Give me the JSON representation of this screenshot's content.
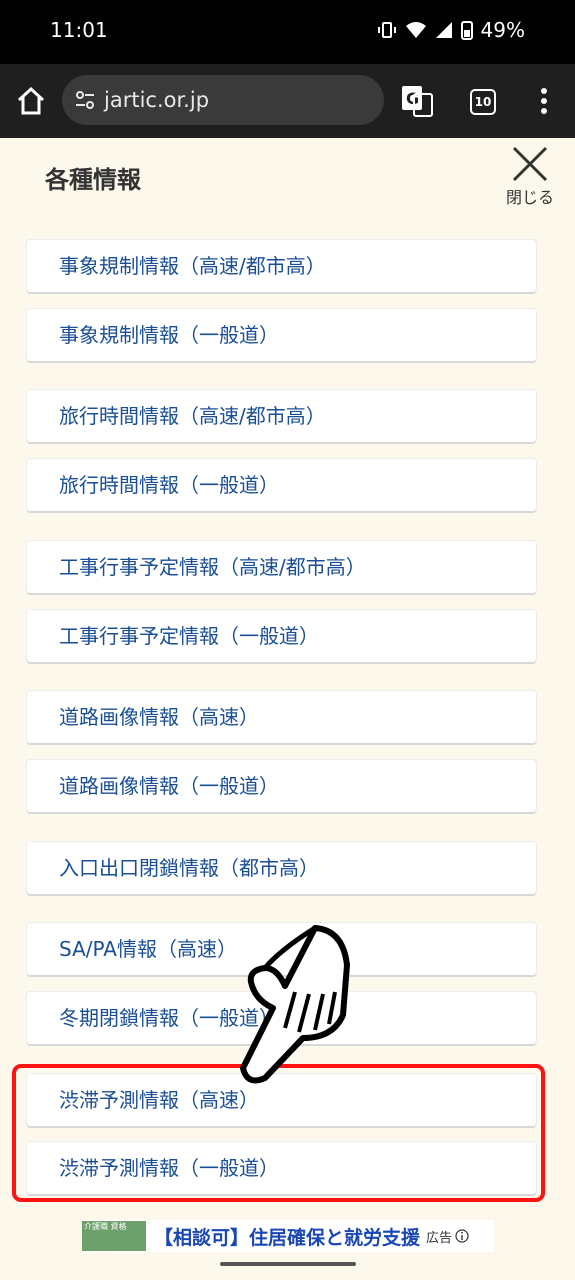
{
  "status": {
    "time": "11:01",
    "battery": "49%"
  },
  "browser": {
    "url": "jartic.or.jp",
    "tab_count": "10"
  },
  "panel": {
    "title": "各種情報",
    "close_label": "閉じる",
    "items": [
      {
        "label": "事象規制情報（高速/都市高）"
      },
      {
        "label": "事象規制情報（一般道）"
      },
      {
        "label": "旅行時間情報（高速/都市高）"
      },
      {
        "label": "旅行時間情報（一般道）"
      },
      {
        "label": "工事行事予定情報（高速/都市高）"
      },
      {
        "label": "工事行事予定情報（一般道）"
      },
      {
        "label": "道路画像情報（高速）"
      },
      {
        "label": "道路画像情報（一般道）"
      },
      {
        "label": "入口出口閉鎖情報（都市高）"
      },
      {
        "label": "SA/PA情報（高速）"
      },
      {
        "label": "冬期閉鎖情報（一般道）"
      },
      {
        "label": "渋滞予測情報（高速）"
      },
      {
        "label": "渋滞予測情報（一般道）"
      }
    ]
  },
  "ad": {
    "thumb_text": "介護職 資格",
    "text": "【相談可】住居確保と就労支援",
    "label": "広告"
  }
}
